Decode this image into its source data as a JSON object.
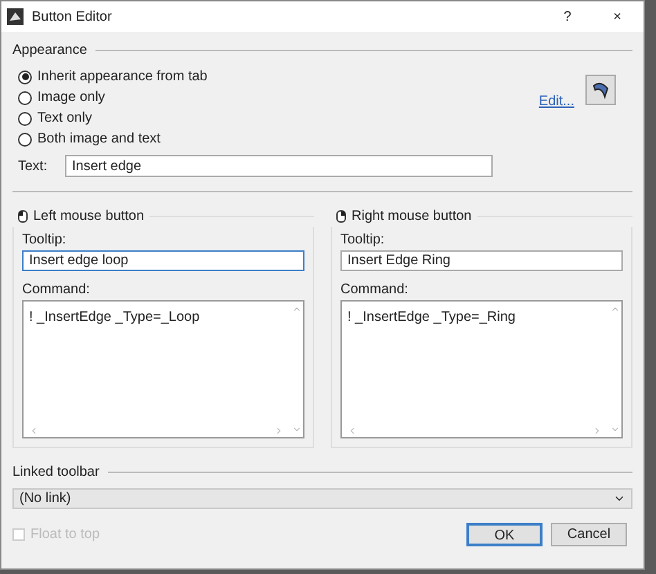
{
  "window": {
    "title": "Button Editor",
    "help": "?",
    "close": "×"
  },
  "appearance": {
    "label": "Appearance",
    "options": [
      {
        "label": "Inherit appearance from tab",
        "selected": true
      },
      {
        "label": "Image only",
        "selected": false
      },
      {
        "label": "Text only",
        "selected": false
      },
      {
        "label": "Both image and text",
        "selected": false
      }
    ],
    "edit_link": "Edit...",
    "text_label": "Text:",
    "text_value": "Insert edge"
  },
  "mouse_buttons": [
    {
      "title": "Left mouse button",
      "tooltip_label": "Tooltip:",
      "tooltip": "Insert edge loop",
      "focused": true,
      "command_label": "Command:",
      "command": "! _InsertEdge _Type=_Loop"
    },
    {
      "title": "Right mouse button",
      "tooltip_label": "Tooltip:",
      "tooltip": "Insert Edge Ring",
      "focused": false,
      "command_label": "Command:",
      "command": "! _InsertEdge _Type=_Ring"
    }
  ],
  "linked_toolbar": {
    "label": "Linked toolbar",
    "value": "(No link)"
  },
  "float_to_top": {
    "label": "Float to top",
    "checked": false,
    "disabled": true
  },
  "buttons": [
    {
      "label": "OK",
      "default": true
    },
    {
      "label": "Cancel",
      "default": false
    }
  ]
}
